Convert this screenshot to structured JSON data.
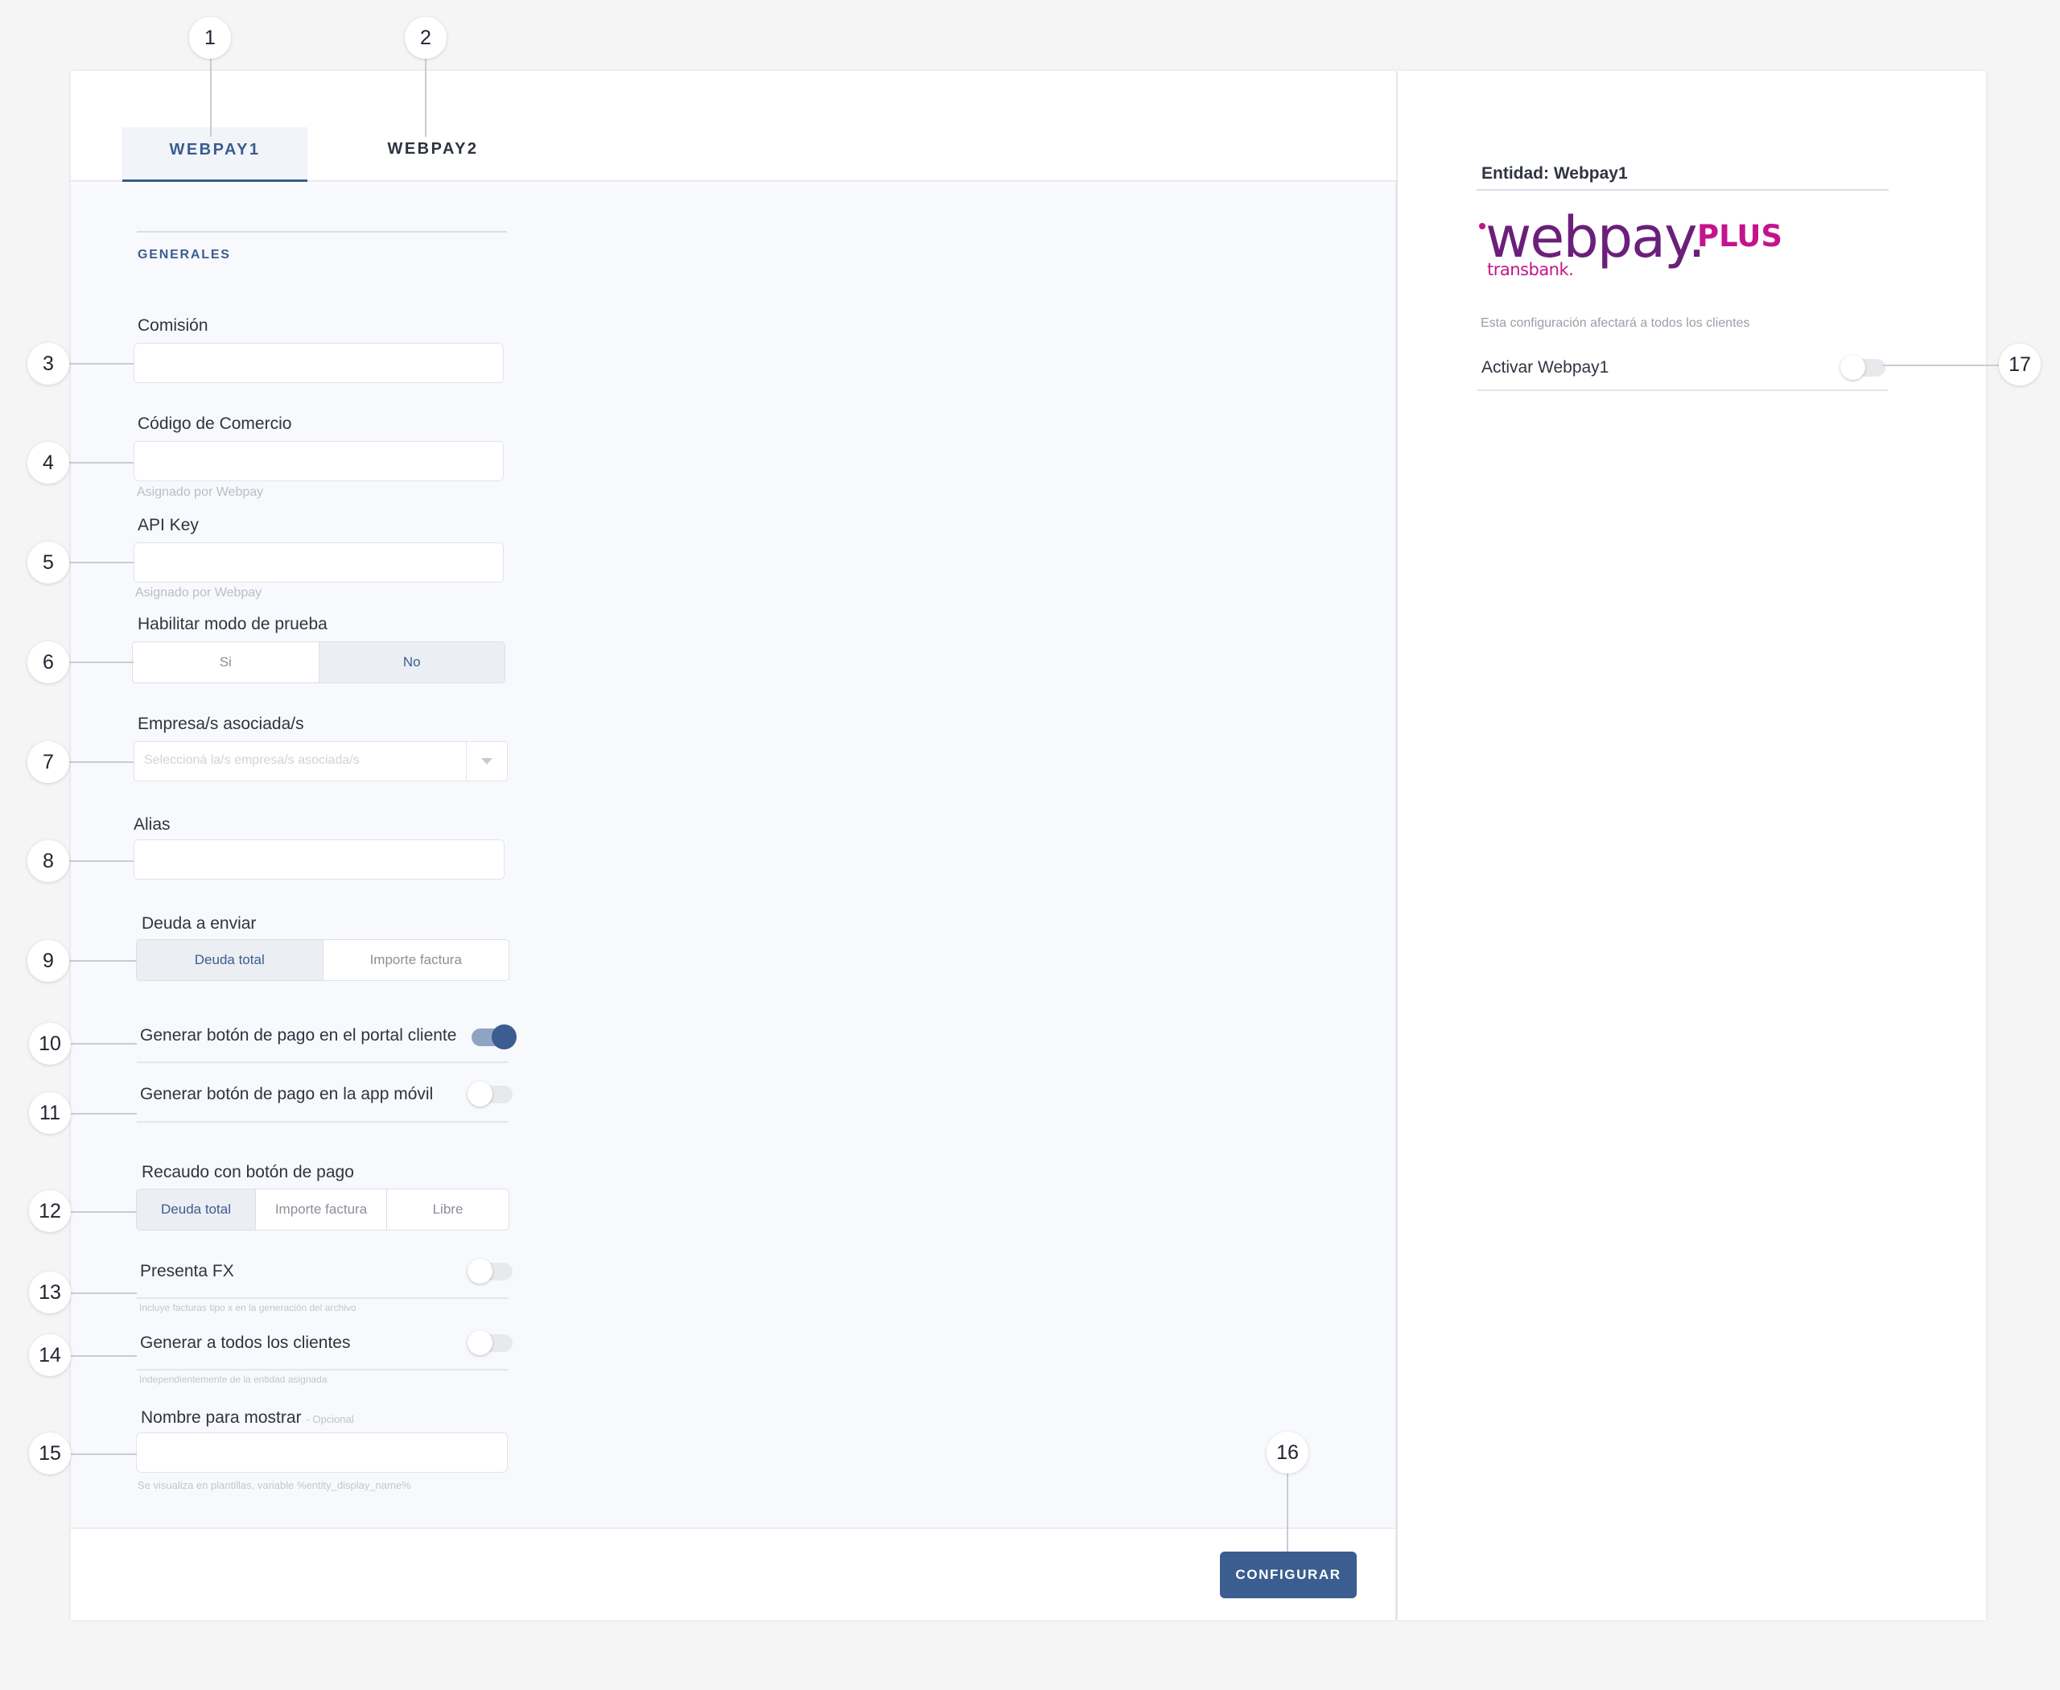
{
  "tabs": [
    {
      "label": "WEBPAY1",
      "active": true
    },
    {
      "label": "WEBPAY2",
      "active": false
    }
  ],
  "section": {
    "title": "GENERALES"
  },
  "fields": {
    "comision": {
      "label": "Comisión",
      "value": ""
    },
    "codigo": {
      "label": "Código de Comercio",
      "value": "",
      "hint": "Asignado por Webpay"
    },
    "apikey": {
      "label": "API Key",
      "value": "",
      "hint": "Asignado por Webpay"
    },
    "modo_prueba": {
      "label": "Habilitar modo de prueba",
      "options": [
        "Si",
        "No"
      ],
      "selected": "No"
    },
    "empresas": {
      "label": "Empresa/s asociada/s",
      "placeholder": "Seleccioná la/s empresa/s asociada/s"
    },
    "alias": {
      "label": "Alias",
      "value": ""
    },
    "deuda": {
      "label": "Deuda a enviar",
      "options": [
        "Deuda total",
        "Importe factura"
      ],
      "selected": "Deuda total"
    },
    "portal": {
      "label": "Generar botón de pago en el portal cliente",
      "on": true
    },
    "app": {
      "label": "Generar botón de pago en la app móvil",
      "on": false
    },
    "recaudo": {
      "label": "Recaudo con botón de pago",
      "options": [
        "Deuda total",
        "Importe factura",
        "Libre"
      ],
      "selected": "Deuda total"
    },
    "fx": {
      "label": "Presenta FX",
      "on": false,
      "hint": "Incluye facturas tipo x en la generación del archivo"
    },
    "todos": {
      "label": "Generar a todos los clientes",
      "on": false,
      "hint": "Independientemente de la entidad asignada"
    },
    "nombre": {
      "label": "Nombre para mostrar",
      "optional": "- Opcional",
      "value": "",
      "hint": "Se visualiza en plantillas, variable %entity_display_name%"
    }
  },
  "footer": {
    "button": "CONFIGURAR"
  },
  "right": {
    "entity": "Entidad: Webpay1",
    "logo": {
      "main": "webpay.",
      "plus": "PLUS",
      "sub": "transbank."
    },
    "note": "Esta configuración afectará a todos los clientes",
    "activar": {
      "label": "Activar Webpay1",
      "on": false
    }
  },
  "callouts": [
    "1",
    "2",
    "3",
    "4",
    "5",
    "6",
    "7",
    "8",
    "9",
    "10",
    "11",
    "12",
    "13",
    "14",
    "15",
    "16",
    "17"
  ],
  "colors": {
    "accent": "#3b5d8f",
    "brand_purple": "#6b1f7a",
    "brand_magenta": "#c4148b"
  }
}
